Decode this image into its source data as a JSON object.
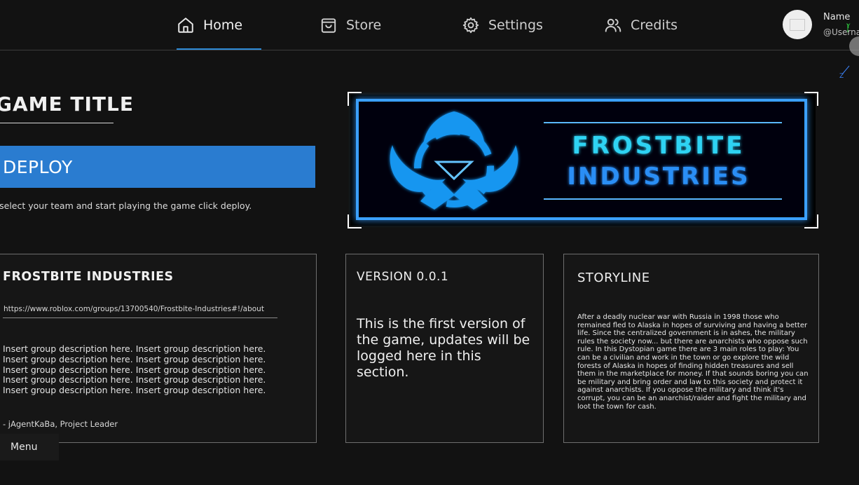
{
  "nav": {
    "items": [
      {
        "label": "Home",
        "icon": "home-icon",
        "active": true
      },
      {
        "label": "Store",
        "icon": "bag-icon"
      },
      {
        "label": "Settings",
        "icon": "gear-icon"
      },
      {
        "label": "Credits",
        "icon": "users-icon"
      }
    ],
    "accent": "#2d8ad6"
  },
  "user": {
    "name": "Name",
    "handle": "@Username"
  },
  "left": {
    "game_title": "GAME TITLE",
    "deploy_label": "DEPLOY",
    "deploy_hint": "To select your team and start playing the game click deploy.",
    "deploy_color": "#2a7cd0"
  },
  "banner": {
    "line1": "FROSTBITE",
    "line2": "INDUSTRIES",
    "glow_color": "#1e90ff"
  },
  "group_panel": {
    "title": "FROSTBITE INDUSTRIES",
    "url": "https://www.roblox.com/groups/13700540/Frostbite-Industries#!/about",
    "description_lines": [
      "Insert group description here. Insert group description here.",
      "Insert group description here. Insert group description here.",
      "Insert group description here. Insert group description here.",
      "Insert group description here. Insert group description here.",
      "Insert group description here. Insert group description here."
    ],
    "signature": "- jAgentKaBa, Project Leader"
  },
  "version_panel": {
    "title": "VERSION 0.0.1",
    "text": "This is the first version of the game, updates will be logged here in this section."
  },
  "story_panel": {
    "title": "STORYLINE",
    "text": "After a deadly nuclear war with Russia in 1998 those who remained fled to Alaska in hopes of surviving and having a better life. Since the centralized government is in ashes, the military rules the society now... but there are anarchists who oppose such rule. In this Dystopian game there are 3 main roles to play: You can be a civilian and work in the town or go explore the wild forests of Alaska in hopes of finding hidden treasures and sell them in the marketplace for money. If that sounds boring you can be military and bring order and law to this society and protect it against anarchists. If you oppose the military and think it's corrupt, you can be an anarchist/raider and fight the military and loot the town for cash."
  },
  "menu": {
    "label": "Menu"
  }
}
